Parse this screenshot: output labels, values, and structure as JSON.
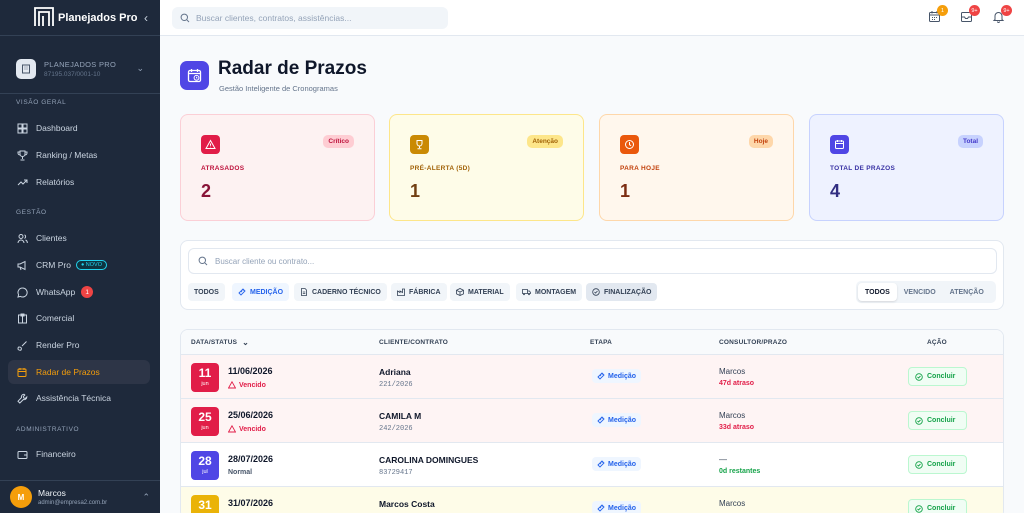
{
  "app": {
    "brand": "Planejados Pro",
    "collapse_glyph": "‹"
  },
  "company": {
    "name": "PLANEJADOS PRO",
    "cnpj": "87195.037/0001-10",
    "chevron": "⌄"
  },
  "sidebar": {
    "section_visao": "VISÃO GERAL",
    "section_gestao": "GESTÃO",
    "section_admin": "ADMINISTRATIVO",
    "items": [
      {
        "label": "Dashboard",
        "icon": "dashboard-icon"
      },
      {
        "label": "Ranking / Metas",
        "icon": "trophy-icon"
      },
      {
        "label": "Relatórios",
        "icon": "trend-icon"
      },
      {
        "label": "Clientes",
        "icon": "users-icon"
      },
      {
        "label": "CRM Pro",
        "icon": "megaphone-icon",
        "badge": "● NOVO"
      },
      {
        "label": "WhatsApp",
        "icon": "whatsapp-icon",
        "badge": "1"
      },
      {
        "label": "Comercial",
        "icon": "clipboard-icon"
      },
      {
        "label": "Render Pro",
        "icon": "brush-icon"
      },
      {
        "label": "Radar de Prazos",
        "icon": "calendar-clock-icon",
        "active": true
      },
      {
        "label": "Assistência Técnica",
        "icon": "wrench-icon"
      },
      {
        "label": "Financeiro",
        "icon": "wallet-icon"
      }
    ]
  },
  "user": {
    "initial": "M",
    "name": "Marcos",
    "email": "admin@empresa2.com.br",
    "chevron": "⌃"
  },
  "topbar": {
    "search_placeholder": "Buscar clientes, contratos, assistências...",
    "badges": {
      "calendar": "1",
      "tasks": "9+",
      "bell": "9+"
    }
  },
  "page": {
    "title": "Radar de Prazos",
    "subtitle": "Gestão Inteligente de Cronogramas"
  },
  "cards": [
    {
      "label": "ATRASADOS",
      "value": "2",
      "tag": "Crítico",
      "icon": "warning-icon",
      "accent": "#e11d48"
    },
    {
      "label": "PRÉ-ALERTA (5D)",
      "value": "1",
      "tag": "Atenção",
      "icon": "trophy-icon",
      "accent": "#ca8a04"
    },
    {
      "label": "PARA HOJE",
      "value": "1",
      "tag": "Hoje",
      "icon": "clock-icon",
      "accent": "#ea580c"
    },
    {
      "label": "TOTAL DE PRAZOS",
      "value": "4",
      "tag": "Total",
      "icon": "calendar-icon",
      "accent": "#4f46e5"
    }
  ],
  "filters": {
    "search_placeholder": "Buscar cliente ou contrato...",
    "chips": [
      "TODOS",
      "MEDIÇÃO",
      "CADERNO TÉCNICO",
      "FÁBRICA",
      "MATERIAL",
      "MONTAGEM",
      "FINALIZAÇÃO"
    ],
    "segments": [
      "TODOS",
      "VENCIDO",
      "ATENÇÃO"
    ]
  },
  "table": {
    "headers": {
      "date": "DATA/STATUS",
      "client": "CLIENTE/CONTRATO",
      "stage": "ETAPA",
      "consultant": "CONSULTOR/PRAZO",
      "action": "AÇÃO"
    },
    "sort_glyph": "⌄",
    "rows": [
      {
        "day": "11",
        "month": "jun",
        "date": "11/06/2026",
        "status": "Vencido",
        "client": "Adriana",
        "contract": "221/2026",
        "stage": "Medição",
        "consultant": "Marcos",
        "deadline": "47d atraso",
        "action": "Concluir"
      },
      {
        "day": "25",
        "month": "jun",
        "date": "25/06/2026",
        "status": "Vencido",
        "client": "CAMILA M",
        "contract": "242/2026",
        "stage": "Medição",
        "consultant": "Marcos",
        "deadline": "33d atraso",
        "action": "Concluir"
      },
      {
        "day": "28",
        "month": "jul",
        "date": "28/07/2026",
        "status": "Normal",
        "client": "CAROLINA DOMINGUES",
        "contract": "83729417",
        "stage": "Medição",
        "consultant": "—",
        "deadline": "0d restantes",
        "action": "Concluir"
      },
      {
        "day": "31",
        "month": "jul",
        "date": "31/07/2026",
        "status": "",
        "client": "Marcos Costa",
        "contract": "",
        "stage": "Medição",
        "consultant": "Marcos",
        "deadline": "",
        "action": "Concluir"
      }
    ]
  }
}
